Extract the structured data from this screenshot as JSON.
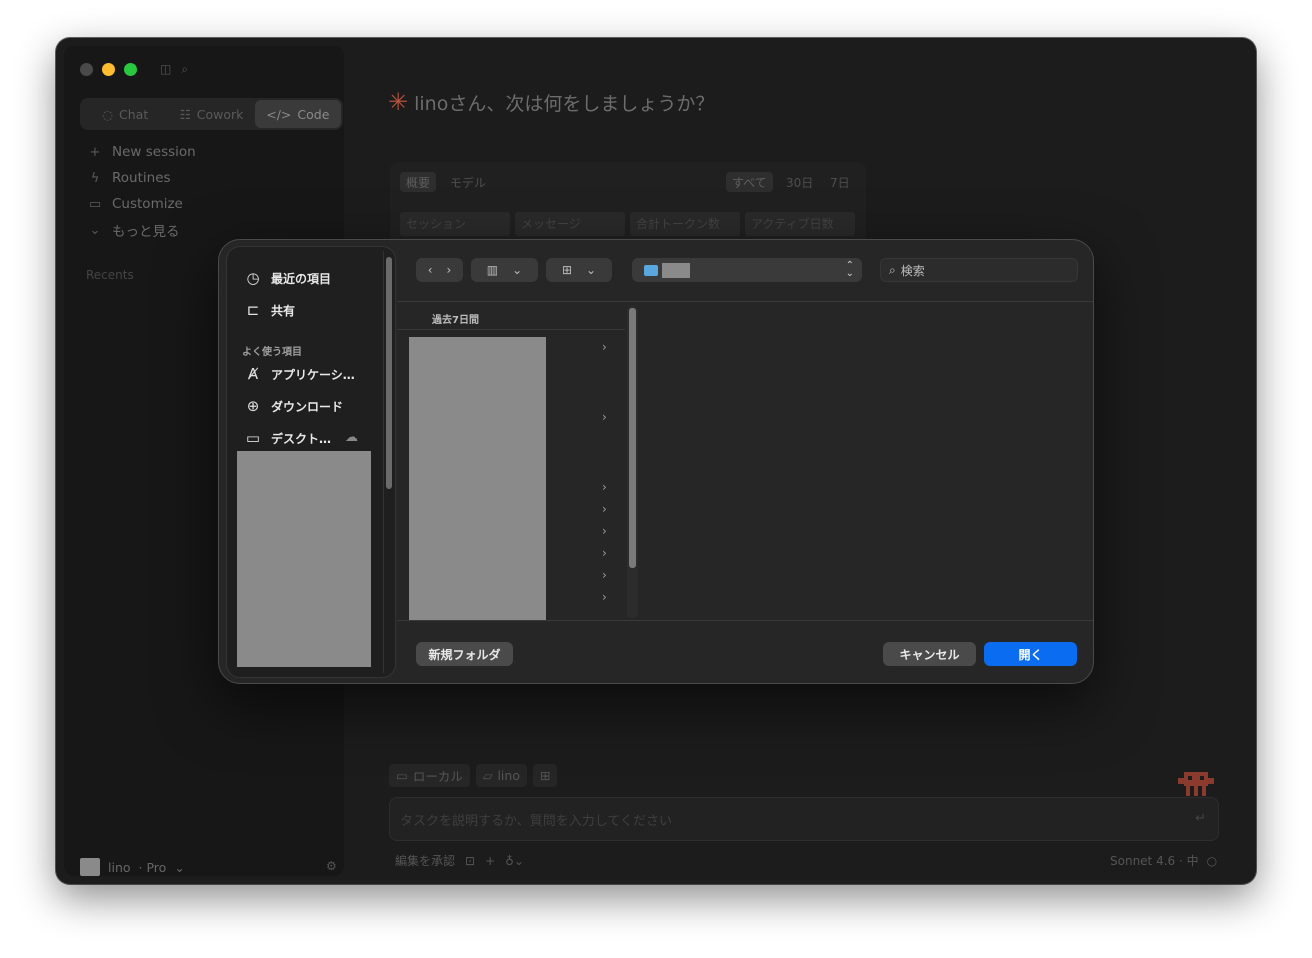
{
  "window": {
    "traffic_lights": [
      "#4a4a4a",
      "#febc2e",
      "#28c840"
    ],
    "sidebar_icons": [
      "sidebar-toggle-icon",
      "search-icon"
    ]
  },
  "sidebar": {
    "modes": [
      {
        "label": "Chat",
        "icon": "chat-icon"
      },
      {
        "label": "Cowork",
        "icon": "cowork-icon"
      },
      {
        "label": "Code",
        "icon": "code-icon"
      }
    ],
    "nav": [
      {
        "label": "New session",
        "icon": "plus-icon"
      },
      {
        "label": "Routines",
        "icon": "bolt-icon"
      },
      {
        "label": "Customize",
        "icon": "briefcase-icon"
      },
      {
        "label": "もっと見る",
        "icon": "chevron-down-icon"
      }
    ],
    "recents_label": "Recents",
    "user": {
      "name": "lino",
      "plan": "· Pro"
    }
  },
  "main": {
    "greeting": "linoさん、次は何をしましょうか？",
    "stats_tabs": [
      "概要",
      "モデル"
    ],
    "range_tabs": [
      "すべて",
      "30日",
      "7日"
    ],
    "stat_cells": [
      "セッション",
      "メッセージ",
      "合計トークン数",
      "アクティブ日数"
    ],
    "chips": [
      {
        "label": "ローカル",
        "icon": "laptop-icon"
      },
      {
        "label": "lino",
        "icon": "folder-icon"
      },
      {
        "label": "",
        "icon": "folder-plus-icon"
      }
    ],
    "prompt_placeholder": "タスクを説明するか、質問を入力してください",
    "accept_edits": "編集を承認",
    "model": "Sonnet 4.6 · 中"
  },
  "dialog": {
    "sidebar": {
      "items": [
        {
          "label": "最近の項目",
          "icon": "clock-icon"
        },
        {
          "label": "共有",
          "icon": "shared-folder-icon"
        }
      ],
      "favorites_heading": "よく使う項目",
      "favorites": [
        {
          "label": "アプリケーシ…",
          "icon": "applications-icon"
        },
        {
          "label": "ダウンロード",
          "icon": "download-icon"
        },
        {
          "label": "デスクト…",
          "icon": "desktop-icon"
        }
      ]
    },
    "search_placeholder": "検索",
    "column_heading": "過去7日間",
    "buttons": {
      "new_folder": "新規フォルダ",
      "cancel": "キャンセル",
      "open": "開く"
    },
    "accent": "#0a6cf0"
  }
}
